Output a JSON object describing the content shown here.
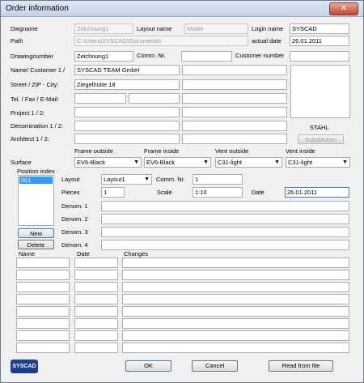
{
  "window": {
    "title": "Order information",
    "close_glyph": "✕"
  },
  "header": {
    "dwgname_label": "Dwgname",
    "dwgname": "Zeichnung1",
    "layout_name_label": "Layout name",
    "layout_name": "Model",
    "login_name_label": "Login name",
    "login_name": "SYSCAD",
    "path_label": "Path",
    "path": "C:\\Users\\SYSCAD\\Documents\\",
    "actual_date_label": "actual date",
    "actual_date": "26.01.2011",
    "drawingnumber_label": "Drawingnumber",
    "drawingnumber": "Zeichnung1",
    "comm_nr_label": "Comm. Nr.",
    "comm_nr": "",
    "customer_number_label": "Customer number",
    "customer_number": ""
  },
  "customer": {
    "name_label": "Name/ Customer 1 /",
    "name1": "SYSCAD TEAM GmbH",
    "name2": "",
    "street_label": "Street / ZIP - City:",
    "street": "Ziegelhütte 18",
    "city": "",
    "tel_label": "Tel. / Fax / E-Mail:",
    "tel": "",
    "fax": "",
    "email": "",
    "project_label": "Project 1 / 2:",
    "project1": "",
    "project2": "",
    "denomination_label": "Denomination 1 / 2:",
    "denomination1": "",
    "denomination2": "",
    "architect_label": "Architect 1 / 2:",
    "architect1": "",
    "architect2": ""
  },
  "material": {
    "name": "STAHL",
    "substitution_label": "Substitution"
  },
  "surface": {
    "label": "Surface",
    "frame_outside_label": "Frame outside",
    "frame_outside": "EV6-Black",
    "frame_inside_label": "Frame inside",
    "frame_inside": "EV6-Black",
    "vent_outside_label": "Vent outside",
    "vent_outside": "C31-light",
    "vent_inside_label": "Vent inside",
    "vent_inside": "C31-light"
  },
  "position": {
    "index_label": "Position index",
    "selected": "001",
    "new_label": "New",
    "delete_label": "Delete",
    "layout_label": "Layout",
    "layout": "Layout1",
    "comm_nr_label": "Comm. Nr.",
    "comm_nr": "1",
    "pieces_label": "Pieces",
    "pieces": "1",
    "scale_label": "Scale",
    "scale": "1:10",
    "date_label": "Date",
    "date": "26.01.2011",
    "denom1_label": "Denom. 1",
    "denom2_label": "Denom. 2",
    "denom3_label": "Denom. 3",
    "denom4_label": "Denom. 4"
  },
  "changes": {
    "name_header": "Name",
    "date_header": "Date",
    "changes_header": "Changes"
  },
  "footer": {
    "logo_text": "SYSCAD",
    "ok_label": "OK",
    "cancel_label": "Cancel",
    "read_label": "Read from file"
  }
}
